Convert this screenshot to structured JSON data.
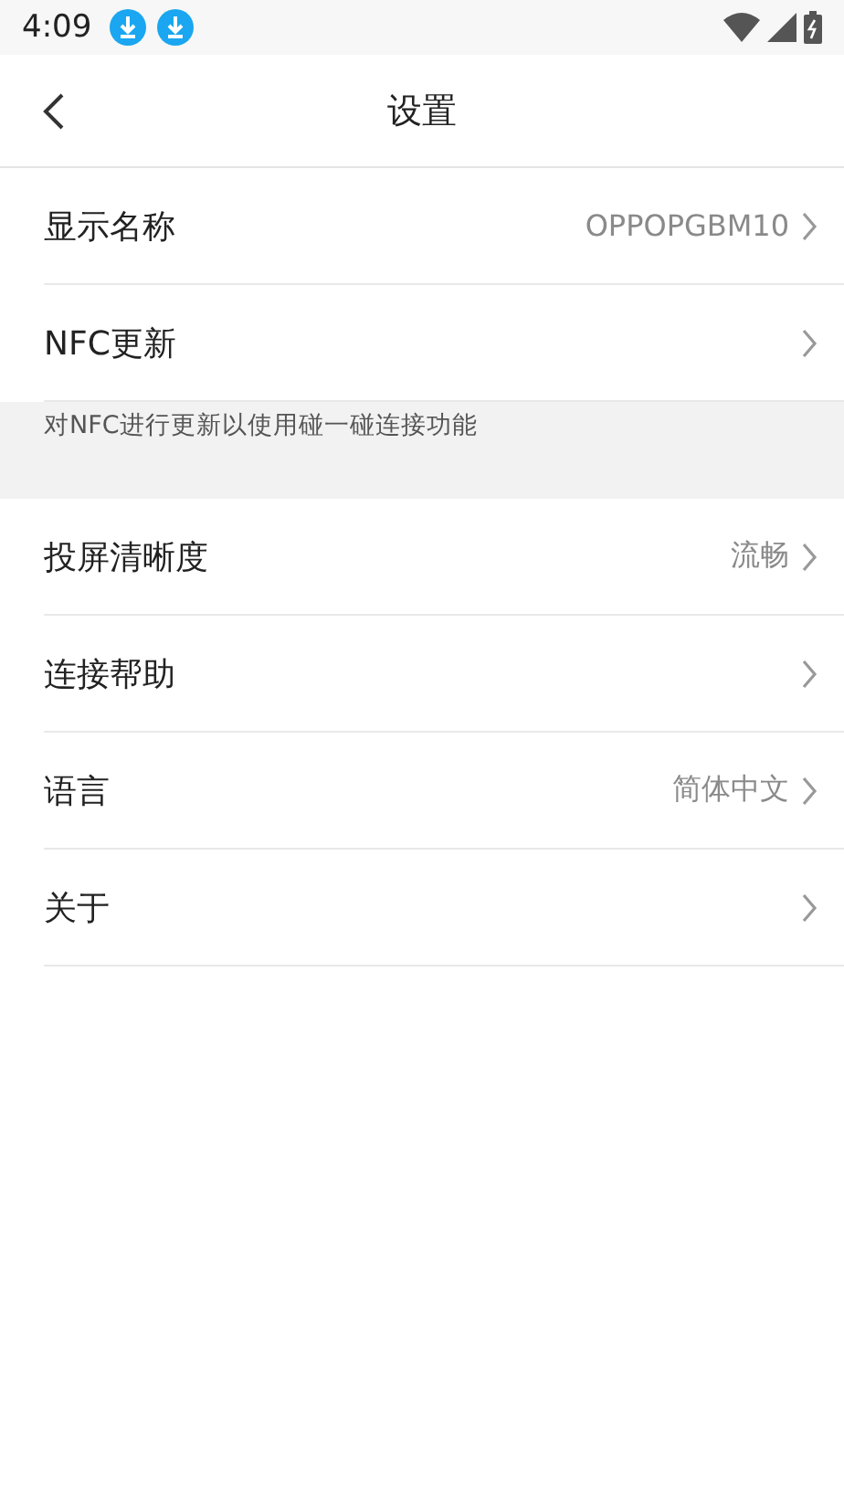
{
  "status_bar": {
    "time": "4:09",
    "notifications": [
      {
        "kind": "download"
      },
      {
        "kind": "download"
      }
    ]
  },
  "header": {
    "title": "设置"
  },
  "groups": [
    {
      "rows": [
        {
          "label": "显示名称",
          "value": "OPPOPGBM10"
        },
        {
          "label": "NFC更新"
        }
      ],
      "note": "对NFC进行更新以使用碰一碰连接功能"
    },
    {
      "rows": [
        {
          "label": "投屏清晰度",
          "value": "流畅"
        },
        {
          "label": "连接帮助"
        },
        {
          "label": "语言",
          "value": "简体中文"
        },
        {
          "label": "关于"
        }
      ]
    }
  ]
}
